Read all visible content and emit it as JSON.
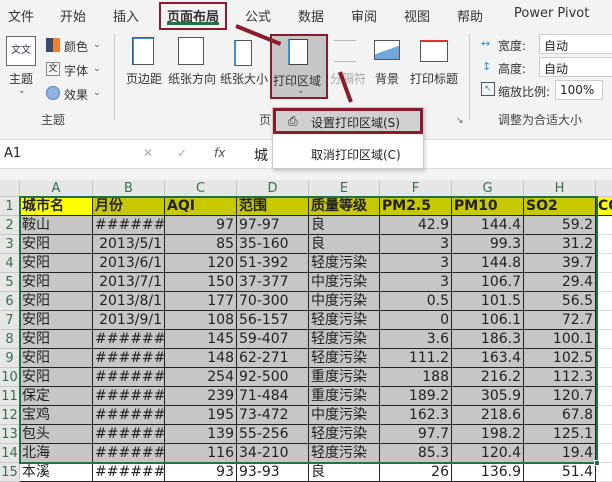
{
  "tabs": [
    "文件",
    "开始",
    "插入",
    "页面布局",
    "公式",
    "数据",
    "审阅",
    "视图",
    "帮助",
    "Power Pivot"
  ],
  "ribbon": {
    "theme": {
      "themes": "主题",
      "colors": "颜色",
      "fonts": "字体",
      "effects": "效果",
      "group": "主题"
    },
    "page_setup": {
      "margins": "页边距",
      "orientation": "纸张方向",
      "size": "纸张大小",
      "print_area": "打印区域",
      "breaks": "分隔符",
      "background": "背景",
      "print_titles": "打印标题",
      "group": "页"
    },
    "scale": {
      "width_label": "宽度:",
      "width_value": "自动",
      "height_label": "高度:",
      "height_value": "自动",
      "scale_label": "缩放比例:",
      "scale_value": "100%",
      "group": "调整为合适大小"
    }
  },
  "menu": {
    "set_print_area": "设置打印区域(S)",
    "clear_print_area": "取消打印区域(C)"
  },
  "formula_bar": {
    "name_box": "A1",
    "cancel": "✕",
    "enter": "✓",
    "fx": "fx",
    "content": "城"
  },
  "sheet": {
    "columns": [
      "A",
      "B",
      "C",
      "D",
      "E",
      "F",
      "G",
      "H"
    ],
    "headers": [
      "城市名",
      "月份",
      "AQI",
      "范围",
      "质量等级",
      "PM2.5",
      "PM10",
      "SO2",
      "CO"
    ],
    "rows": [
      [
        "鞍山",
        "#######",
        "97",
        "97-97",
        "良",
        "42.9",
        "144.4",
        "59.2"
      ],
      [
        "安阳",
        "2013/5/1",
        "85",
        "35-160",
        "良",
        "3",
        "99.3",
        "31.2"
      ],
      [
        "安阳",
        "2013/6/1",
        "120",
        "51-392",
        "轻度污染",
        "3",
        "144.8",
        "39.7"
      ],
      [
        "安阳",
        "2013/7/1",
        "150",
        "37-377",
        "中度污染",
        "3",
        "106.7",
        "29.4"
      ],
      [
        "安阳",
        "2013/8/1",
        "177",
        "70-300",
        "中度污染",
        "0.5",
        "101.5",
        "56.5"
      ],
      [
        "安阳",
        "2013/9/1",
        "108",
        "56-157",
        "轻度污染",
        "0",
        "106.1",
        "72.7"
      ],
      [
        "安阳",
        "#######",
        "145",
        "59-407",
        "轻度污染",
        "3.6",
        "186.3",
        "100.1"
      ],
      [
        "安阳",
        "#######",
        "148",
        "62-271",
        "轻度污染",
        "111.2",
        "163.4",
        "102.5"
      ],
      [
        "安阳",
        "#######",
        "254",
        "92-500",
        "重度污染",
        "188",
        "216.2",
        "112.3"
      ],
      [
        "保定",
        "#######",
        "239",
        "71-484",
        "重度污染",
        "189.2",
        "305.9",
        "120.7"
      ],
      [
        "宝鸡",
        "#######",
        "195",
        "73-472",
        "中度污染",
        "162.3",
        "218.6",
        "67.8"
      ],
      [
        "包头",
        "#######",
        "139",
        "55-256",
        "轻度污染",
        "97.7",
        "198.2",
        "125.1"
      ],
      [
        "北海",
        "#######",
        "116",
        "34-210",
        "轻度污染",
        "85.3",
        "120.4",
        "19.4"
      ],
      [
        "本溪",
        "#######",
        "93",
        "93-93",
        "良",
        "26",
        "136.9",
        "51.4"
      ]
    ]
  }
}
